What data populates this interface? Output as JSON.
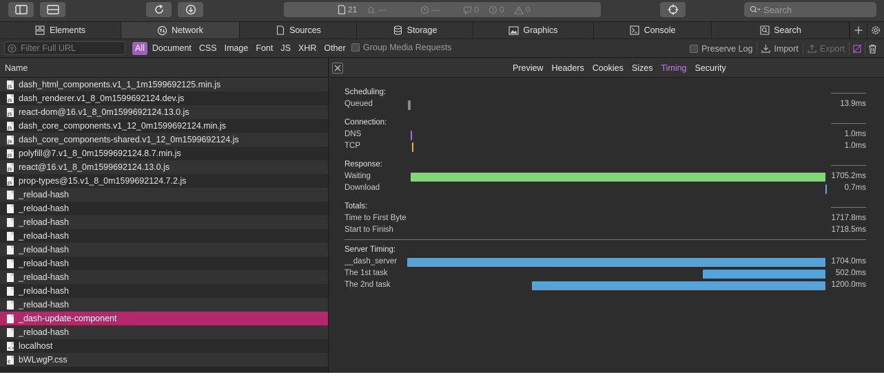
{
  "toolbar": {
    "resource_count": "21",
    "bell_value": "—",
    "clock_value": "—",
    "messages": "0",
    "errors": "0",
    "warnings": "0",
    "search_placeholder": "Search"
  },
  "tabs": [
    {
      "label": "Elements",
      "icon": "elements-icon"
    },
    {
      "label": "Network",
      "icon": "network-icon",
      "active": true
    },
    {
      "label": "Sources",
      "icon": "sources-icon"
    },
    {
      "label": "Storage",
      "icon": "storage-icon"
    },
    {
      "label": "Graphics",
      "icon": "graphics-icon"
    },
    {
      "label": "Console",
      "icon": "console-icon"
    },
    {
      "label": "Search",
      "icon": "search-icon"
    }
  ],
  "filter": {
    "placeholder": "Filter Full URL",
    "types": [
      "All",
      "Document",
      "CSS",
      "Image",
      "Font",
      "JS",
      "XHR",
      "Other"
    ],
    "active_type": "All",
    "group_media": "Group Media Requests",
    "preserve_log": "Preserve Log",
    "import": "Import",
    "export": "Export"
  },
  "list": {
    "header": "Name",
    "rows": [
      {
        "name": "dash_html_components.v1_1_1m1599692125.min.js",
        "type": "js"
      },
      {
        "name": "dash_renderer.v1_8_0m1599692124.dev.js",
        "type": "js"
      },
      {
        "name": "react-dom@16.v1_8_0m1599692124.13.0.js",
        "type": "js"
      },
      {
        "name": "dash_core_components.v1_12_0m1599692124.min.js",
        "type": "js"
      },
      {
        "name": "dash_core_components-shared.v1_12_0m1599692124.js",
        "type": "js"
      },
      {
        "name": "polyfill@7.v1_8_0m1599692124.8.7.min.js",
        "type": "js"
      },
      {
        "name": "react@16.v1_8_0m1599692124.13.0.js",
        "type": "js"
      },
      {
        "name": "prop-types@15.v1_8_0m1599692124.7.2.js",
        "type": "js"
      },
      {
        "name": "_reload-hash",
        "type": "other"
      },
      {
        "name": "_reload-hash",
        "type": "other"
      },
      {
        "name": "_reload-hash",
        "type": "other"
      },
      {
        "name": "_reload-hash",
        "type": "other"
      },
      {
        "name": "_reload-hash",
        "type": "other"
      },
      {
        "name": "_reload-hash",
        "type": "other"
      },
      {
        "name": "_reload-hash",
        "type": "other"
      },
      {
        "name": "_reload-hash",
        "type": "other"
      },
      {
        "name": "_reload-hash",
        "type": "other"
      },
      {
        "name": "_dash-update-component",
        "type": "other",
        "selected": true
      },
      {
        "name": "_reload-hash",
        "type": "other"
      },
      {
        "name": "localhost",
        "type": "doc"
      },
      {
        "name": "bWLwgP.css",
        "type": "css"
      }
    ]
  },
  "detail": {
    "tabs": [
      "Preview",
      "Headers",
      "Cookies",
      "Sizes",
      "Timing",
      "Security"
    ],
    "active_tab": "Timing",
    "timing": {
      "sections": [
        {
          "title": "Scheduling:",
          "items": [
            {
              "label": "Queued",
              "value": "13.9ms",
              "color": "#8a8a8a"
            }
          ]
        },
        {
          "title": "Connection:",
          "items": [
            {
              "label": "DNS",
              "value": "1.0ms",
              "color": "#9b6cf0"
            },
            {
              "label": "TCP",
              "value": "1.0ms",
              "color": "#f0b43c"
            }
          ]
        },
        {
          "title": "Response:",
          "items": [
            {
              "label": "Waiting",
              "value": "1705.2ms",
              "color": "#7fd873"
            },
            {
              "label": "Download",
              "value": "0.7ms",
              "color": "#5aaee0"
            }
          ]
        },
        {
          "title": "Totals:",
          "items": [
            {
              "label": "Time to First Byte",
              "value": "1717.8ms"
            },
            {
              "label": "Start to Finish",
              "value": "1718.5ms"
            }
          ]
        },
        {
          "title": "Server Timing:",
          "items": [
            {
              "label": "__dash_server",
              "value": "1704.0ms",
              "color": "#55a3d9"
            },
            {
              "label": "The 1st task",
              "value": "502.0ms",
              "color": "#55a3d9"
            },
            {
              "label": "The 2nd task",
              "value": "1200.0ms",
              "color": "#55a3d9"
            }
          ]
        }
      ]
    }
  }
}
